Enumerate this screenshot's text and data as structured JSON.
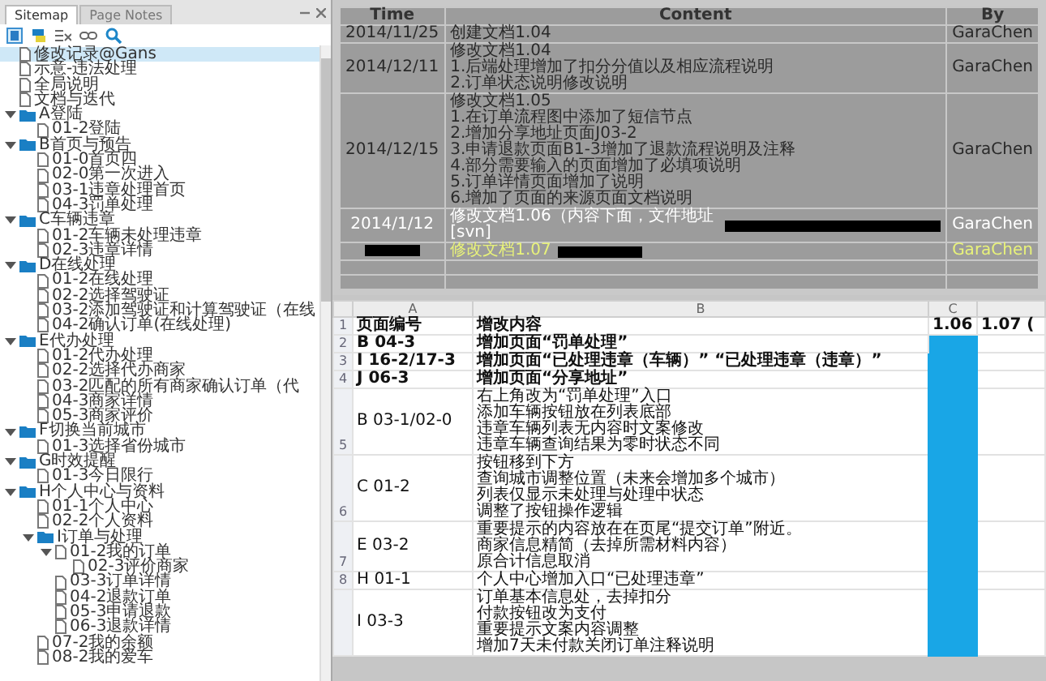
{
  "sidebar": {
    "tabs": [
      {
        "label": "Sitemap",
        "selected": true
      },
      {
        "label": "Page Notes",
        "selected": false
      }
    ],
    "tree": [
      {
        "label": "修改记录@Gans",
        "kind": "page",
        "selected": true
      },
      {
        "label": "示意-违法处理",
        "kind": "page",
        "selected": false
      },
      {
        "label": "全局说明",
        "kind": "page",
        "selected": false
      },
      {
        "label": "文档与迭代",
        "kind": "page",
        "selected": false
      },
      {
        "label": "A登陆",
        "kind": "folder",
        "selected": false,
        "expanded": true,
        "children": [
          {
            "label": "01-2登陆",
            "kind": "page",
            "selected": false
          }
        ]
      },
      {
        "label": "B首页与预告",
        "kind": "folder",
        "selected": false,
        "expanded": true,
        "children": [
          {
            "label": "01-0首页四",
            "kind": "page",
            "selected": false
          },
          {
            "label": "02-0第一次进入",
            "kind": "page",
            "selected": false
          },
          {
            "label": "03-1违章处理首页",
            "kind": "page",
            "selected": false
          },
          {
            "label": "04-3罚单处理",
            "kind": "page",
            "selected": false
          }
        ]
      },
      {
        "label": "C车辆违章",
        "kind": "folder",
        "selected": false,
        "expanded": true,
        "children": [
          {
            "label": "01-2车辆未处理违章",
            "kind": "page",
            "selected": false
          },
          {
            "label": "02-3违章详情",
            "kind": "page",
            "selected": false
          }
        ]
      },
      {
        "label": "D在线处理",
        "kind": "folder",
        "selected": false,
        "expanded": true,
        "children": [
          {
            "label": "01-2在线处理",
            "kind": "page",
            "selected": false
          },
          {
            "label": "02-2选择驾驶证",
            "kind": "page",
            "selected": false
          },
          {
            "label": "03-2添加驾驶证和计算驾驶证（在线",
            "kind": "page",
            "selected": false
          },
          {
            "label": "04-2确认订单(在线处理)",
            "kind": "page",
            "selected": false
          }
        ]
      },
      {
        "label": "E代办处理",
        "kind": "folder",
        "selected": false,
        "expanded": true,
        "children": [
          {
            "label": "01-2代办处理",
            "kind": "page",
            "selected": false
          },
          {
            "label": "02-2选择代办商家",
            "kind": "page",
            "selected": false
          },
          {
            "label": "03-2匹配的所有商家确认订单（代",
            "kind": "page",
            "selected": false
          },
          {
            "label": "04-3商家详情",
            "kind": "page",
            "selected": false
          },
          {
            "label": "05-3商家评价",
            "kind": "page",
            "selected": false
          }
        ]
      },
      {
        "label": "F切换当前城市",
        "kind": "folder",
        "selected": false,
        "expanded": true,
        "children": [
          {
            "label": "01-3选择省份城市",
            "kind": "page",
            "selected": false
          }
        ]
      },
      {
        "label": "G时效提醒",
        "kind": "folder",
        "selected": false,
        "expanded": true,
        "children": [
          {
            "label": "01-3今日限行",
            "kind": "page",
            "selected": false
          }
        ]
      },
      {
        "label": "H个人中心与资料",
        "kind": "folder",
        "selected": false,
        "expanded": true,
        "children": [
          {
            "label": "01-1个人中心",
            "kind": "page",
            "selected": false
          },
          {
            "label": "02-2个人资料",
            "kind": "page",
            "selected": false
          },
          {
            "label": "I订单与处理",
            "kind": "folder",
            "selected": false,
            "expanded": true,
            "children": [
              {
                "label": "01-2我的订单",
                "kind": "page",
                "selected": false,
                "expanded": true,
                "children": [
                  {
                    "label": "02-3评价商家",
                    "kind": "page",
                    "selected": false
                  }
                ]
              },
              {
                "label": "03-3订单详情",
                "kind": "page",
                "selected": false
              },
              {
                "label": "04-2退款订单",
                "kind": "page",
                "selected": false
              },
              {
                "label": "05-3申请退款",
                "kind": "page",
                "selected": false
              },
              {
                "label": "06-3退款详情",
                "kind": "page",
                "selected": false
              }
            ]
          },
          {
            "label": "07-2我的余额",
            "kind": "page",
            "selected": false
          },
          {
            "label": "08-2我的爱车",
            "kind": "page",
            "selected": false
          }
        ]
      }
    ]
  },
  "revision_table": {
    "columns": [
      "Time",
      "Content",
      "By"
    ],
    "rows": [
      {
        "time": "2014/11/25",
        "content": [
          "创建文档1.04"
        ],
        "by": "GaraChen",
        "color": "#2a2a2a"
      },
      {
        "time": "2014/12/11",
        "content": [
          "修改文档1.04",
          "1.后端处理增加了扣分分值以及相应流程说明",
          "2.订单状态说明修改说明"
        ],
        "by": "GaraChen",
        "color": "#2a2a2a"
      },
      {
        "time": "2014/12/15",
        "content": [
          "修改文档1.05",
          "1.在订单流程图中添加了短信节点",
          "2.增加分享地址页面J03-2",
          "3.申请退款页面B1-3增加了退款流程说明及注释",
          "4.部分需要输入的页面增加了必填项说明",
          "5.订单详情页面增加了说明",
          "6.增加了页面的来源页面文档说明"
        ],
        "by": "GaraChen",
        "color": "#2a2a2a"
      },
      {
        "time": "2014/1/12",
        "content": [
          "修改文档1.06（内容下面，文件地址[svn]"
        ],
        "redacted_after_content": true,
        "by": "GaraChen",
        "color": "#ffffff"
      },
      {
        "time_redacted": true,
        "content": [
          "修改文档1.07"
        ],
        "redacted_after_content": true,
        "by": "GaraChen",
        "color": "#e8f27a"
      },
      {
        "kind": "blank"
      },
      {
        "kind": "blank"
      }
    ]
  },
  "spreadsheet": {
    "columns": [
      {
        "letter": "A"
      },
      {
        "letter": "B"
      },
      {
        "letter": "C",
        "highlighted": true
      },
      {}
    ],
    "rows": [
      {
        "number": "1",
        "kind": "heading",
        "bold": true,
        "page_id": "页面编号",
        "changes": [
          "增改内容"
        ],
        "col_c": "1.06",
        "col_d": "1.07 ("
      },
      {
        "number": "2",
        "kind": "data",
        "bold": true,
        "page_id": "B 04-3",
        "changes": [
          "增加页面“罚单处理”"
        ]
      },
      {
        "number": "3",
        "kind": "data",
        "bold": true,
        "page_id": "I 16-2/17-3",
        "changes": [
          "增加页面“已处理违章（车辆）” “已处理违章（违章）”"
        ]
      },
      {
        "number": "4",
        "kind": "data",
        "bold": true,
        "page_id": "J 06-3",
        "changes": [
          "增加页面“分享地址”"
        ]
      },
      {
        "number": "5",
        "kind": "data",
        "bold": false,
        "page_id": "B 03-1/02-0",
        "changes": [
          "右上角改为“罚单处理”入口",
          "添加车辆按钮放在列表底部",
          "违章车辆列表无内容时文案修改",
          "违章车辆查询结果为零时状态不同"
        ]
      },
      {
        "number": "6",
        "kind": "data",
        "bold": false,
        "page_id": "C 01-2",
        "changes": [
          "按钮移到下方",
          "查询城市调整位置（未来会增加多个城市）",
          "列表仅显示未处理与处理中状态",
          "调整了按钮操作逻辑"
        ]
      },
      {
        "number": "7",
        "kind": "data",
        "bold": false,
        "page_id": "E 03-2",
        "changes": [
          "重要提示的内容放在在页尾“提交订单”附近。",
          "商家信息精简（去掉所需材料内容）",
          "原合计信息取消"
        ]
      },
      {
        "number": "8",
        "kind": "data",
        "bold": false,
        "page_id": "H 01-1",
        "changes": [
          "个人中心增加入口“已处理违章”"
        ]
      },
      {
        "kind": "data",
        "bold": false,
        "page_id": "I 03-3",
        "changes": [
          "订单基本信息处，去掉扣分",
          "付款按钮改为支付",
          "重要提示文案内容调整",
          "增加7天未付款关闭订单注释说明"
        ]
      }
    ]
  }
}
